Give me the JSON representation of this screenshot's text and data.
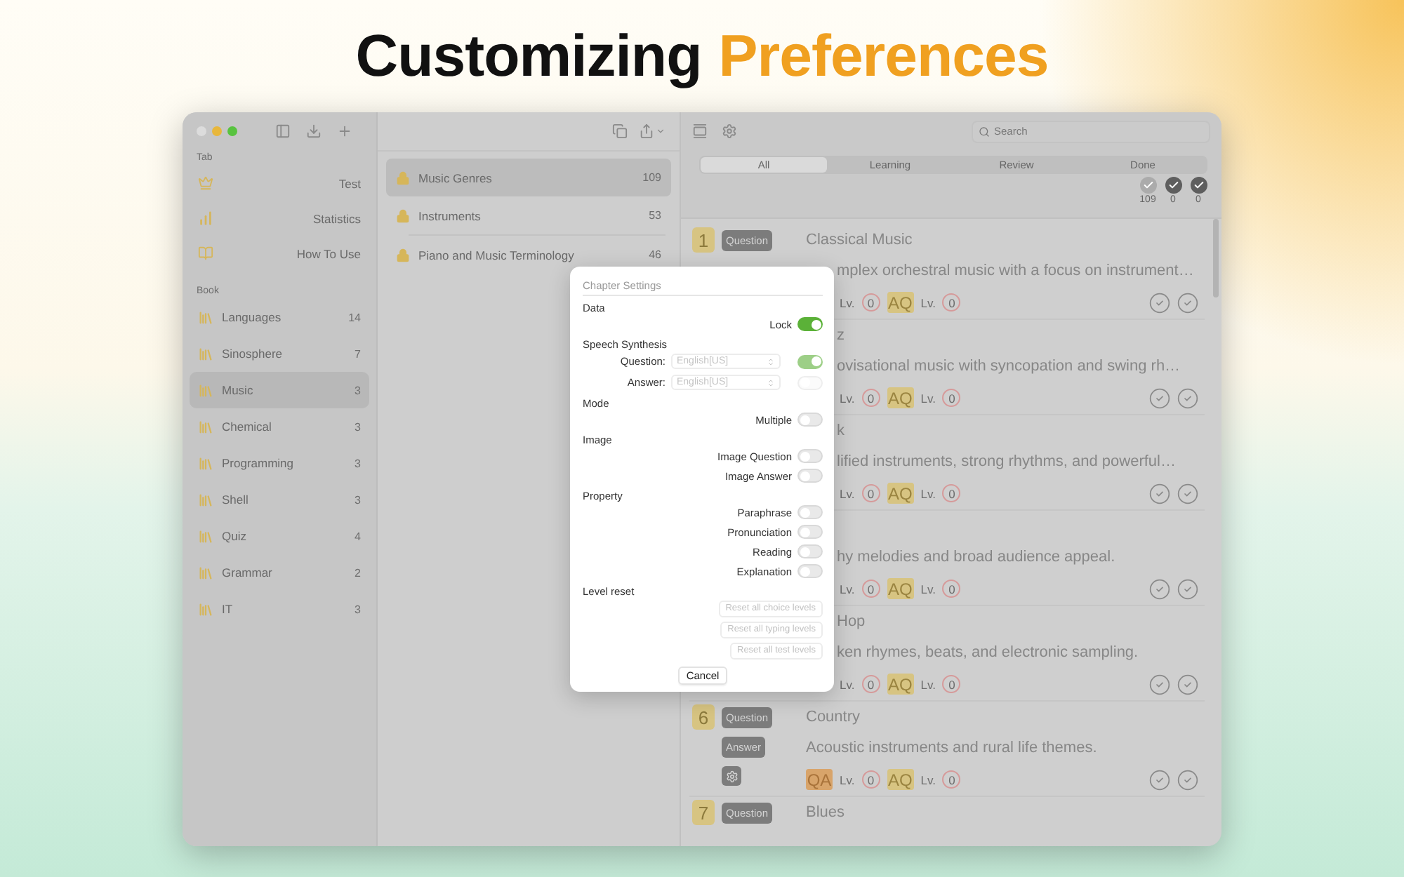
{
  "headline": {
    "text": "Customizing",
    "highlight": "Preferences"
  },
  "sidebar": {
    "sections": [
      {
        "heading": "Tab",
        "kind": "tab",
        "items": [
          {
            "label": "Test",
            "selected": false
          },
          {
            "label": "Statistics",
            "selected": false
          },
          {
            "label": "How To Use",
            "selected": false
          }
        ]
      },
      {
        "heading": "Book",
        "kind": "book",
        "items": [
          {
            "label": "Languages",
            "count": "14",
            "selected": false
          },
          {
            "label": "Sinosphere",
            "count": "7",
            "selected": false
          },
          {
            "label": "Music",
            "count": "3",
            "selected": true
          },
          {
            "label": "Chemical",
            "count": "3",
            "selected": false
          },
          {
            "label": "Programming",
            "count": "3",
            "selected": false
          },
          {
            "label": "Shell",
            "count": "3",
            "selected": false
          },
          {
            "label": "Quiz",
            "count": "4",
            "selected": false
          },
          {
            "label": "Grammar",
            "count": "2",
            "selected": false
          },
          {
            "label": "IT",
            "count": "3",
            "selected": false
          }
        ]
      }
    ]
  },
  "chapters": [
    {
      "label": "Music Genres",
      "count": "109",
      "selected": true
    },
    {
      "label": "Instruments",
      "count": "53",
      "selected": false
    },
    {
      "label": "Piano and Music Terminology",
      "count": "46",
      "selected": false
    }
  ],
  "search": {
    "placeholder": "Search"
  },
  "filters": [
    {
      "label": "All",
      "selected": true
    },
    {
      "label": "Learning",
      "selected": false
    },
    {
      "label": "Review",
      "selected": false
    },
    {
      "label": "Done",
      "selected": false
    }
  ],
  "stats": [
    {
      "count": "109",
      "color": "#ababab"
    },
    {
      "count": "0",
      "color": "#5e5e5e"
    },
    {
      "count": "0",
      "color": "#5e5e5e"
    }
  ],
  "cards": [
    {
      "number": "1",
      "question": "Question",
      "title": {
        "text": "Classical Music"
      },
      "answer": {
        "text": "mplex orchestral music with a focus on instrument…",
        "cut": true
      },
      "levels": {
        "lv1": "Lv.",
        "n1": "0",
        "aq": "AQ",
        "lv2": "Lv.",
        "n2": "0"
      }
    },
    {
      "title": {
        "text": "z",
        "cut": true
      },
      "answer": {
        "text": "ovisational music with syncopation and swing rh…",
        "cut": true
      },
      "levels": {
        "lv1": "Lv.",
        "n1": "0",
        "aq": "AQ",
        "lv2": "Lv.",
        "n2": "0"
      }
    },
    {
      "title": {
        "text": "k",
        "cut": true
      },
      "answer": {
        "text": "lified instruments, strong rhythms, and powerful…",
        "cut": true
      },
      "levels": {
        "lv1": "Lv.",
        "n1": "0",
        "aq": "AQ",
        "lv2": "Lv.",
        "n2": "0"
      }
    },
    {
      "answer": {
        "text": "hy melodies and broad audience appeal.",
        "cut": true
      },
      "levels": {
        "lv1": "Lv.",
        "n1": "0",
        "aq": "AQ",
        "lv2": "Lv.",
        "n2": "0"
      }
    },
    {
      "title": {
        "text": "Hop",
        "cut": true
      },
      "answer": {
        "text": "ken rhymes, beats, and electronic sampling.",
        "cut": true
      },
      "levels": {
        "lv1": "Lv.",
        "n1": "0",
        "aq": "AQ",
        "lv2": "Lv.",
        "n2": "0"
      }
    },
    {
      "number": "6",
      "question": "Question",
      "answer_button": "Answer",
      "settings": true,
      "title": {
        "text": "Country"
      },
      "answer": {
        "text": "Acoustic instruments and rural life themes."
      },
      "levels": {
        "qa": "QA",
        "lv1": "Lv.",
        "n1": "0",
        "aq": "AQ",
        "lv2": "Lv.",
        "n2": "0"
      }
    },
    {
      "number": "7",
      "question": "Question",
      "title": {
        "text": "Blues"
      }
    }
  ],
  "dialog": {
    "title": "Chapter Settings",
    "cancel": "Cancel",
    "sections": [
      {
        "heading": "Data",
        "rows": [
          {
            "kind": "toggle",
            "label": "Lock",
            "on": true
          }
        ]
      },
      {
        "heading": "Speech Synthesis",
        "rows": [
          {
            "kind": "select",
            "label": "Question:",
            "value": "English[US]",
            "on": true,
            "disabled": true
          },
          {
            "kind": "select",
            "label": "Answer:",
            "value": "English[US]",
            "on": false,
            "disabled": true
          }
        ]
      },
      {
        "heading": "Mode",
        "rows": [
          {
            "kind": "toggle",
            "label": "Multiple",
            "on": false
          }
        ]
      },
      {
        "heading": "Image",
        "rows": [
          {
            "kind": "toggle",
            "label": "Image Question",
            "on": false
          },
          {
            "kind": "toggle",
            "label": "Image Answer",
            "on": false
          }
        ]
      },
      {
        "heading": "Property",
        "rows": [
          {
            "kind": "toggle",
            "label": "Paraphrase",
            "on": false
          },
          {
            "kind": "toggle",
            "label": "Pronunciation",
            "on": false
          },
          {
            "kind": "toggle",
            "label": "Reading",
            "on": false
          },
          {
            "kind": "toggle",
            "label": "Explanation",
            "on": false
          }
        ]
      },
      {
        "heading": "Level reset",
        "rows": [
          {
            "kind": "button",
            "label": "Reset all choice levels",
            "disabled": true
          },
          {
            "kind": "button",
            "label": "Reset all typing levels",
            "disabled": true
          },
          {
            "kind": "button",
            "label": "Reset all test levels",
            "disabled": true
          }
        ]
      }
    ]
  }
}
